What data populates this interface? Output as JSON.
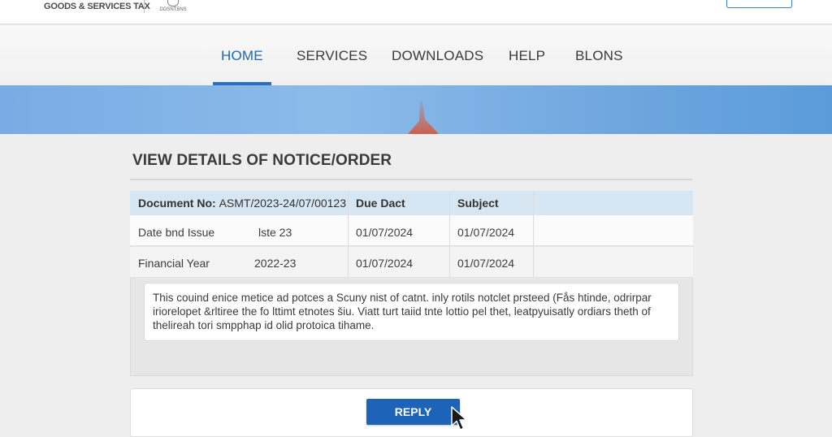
{
  "header": {
    "brand_text": "GOODS & SERVICES TAX",
    "emblem_text": "DOSNTBNS"
  },
  "nav": {
    "items": [
      {
        "label": "HOME",
        "active": true
      },
      {
        "label": "SERVICES",
        "active": false
      },
      {
        "label": "DOWNLOADS",
        "active": false
      },
      {
        "label": "HELP",
        "active": false
      },
      {
        "label": "BLONS",
        "active": false
      }
    ]
  },
  "page": {
    "title": "VIEW DETAILS OF NOTICE/ORDER"
  },
  "table": {
    "header": {
      "document_label": "Document No:",
      "document_value": "ASMT/2023-24/07/00123",
      "due_label": "Due Dact",
      "subject_label": "Subject"
    },
    "rows": [
      {
        "label": "Date bnd Issue",
        "value": "lste 23",
        "due": "01/07/2024",
        "subject": "01/07/2024"
      },
      {
        "label": "Financial Year",
        "value": "2022-23",
        "due": "01/07/2024",
        "subject": "01/07/2024"
      }
    ]
  },
  "notice": {
    "line1": "This couind enice metice ad potces a Scuny nist of catnt. inly rotils notclet prsteed (Fås htinde, odrirpar",
    "line2": "iriorelopet &rltiree the fo lttimt etnotes šiu. Viatt turt taiid tnte lottio pel thet, leatpyuisatly ordiars theth of",
    "line3": "thelireah tori smpphap id olid protoica tihame."
  },
  "actions": {
    "reply_label": "REPLY"
  },
  "colors": {
    "accent": "#1d64b9",
    "nav_active": "#1f66b4",
    "table_header": "#d7e6f3",
    "banner": "#79ace4"
  }
}
